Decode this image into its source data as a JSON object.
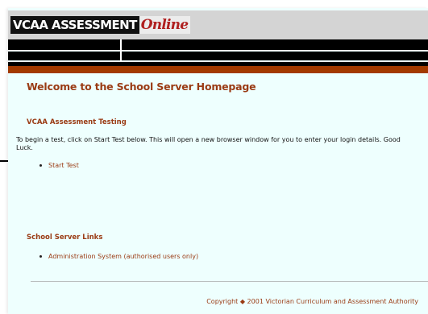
{
  "logo": {
    "main_text": "VCAA ASSESSMENT",
    "accent_text": "Online"
  },
  "page": {
    "welcome_heading": "Welcome to the School Server Homepage"
  },
  "assessment_section": {
    "heading": "VCAA Assessment Testing",
    "intro": "To begin a test, click on Start Test below. This will open a new browser window for you to enter your login details. Good Luck.",
    "start_test_link": "Start Test"
  },
  "links_section": {
    "heading": "School Server Links",
    "admin_link": "Administration System (authorised users only)"
  },
  "footer": {
    "copyright": "Copyright ◆ 2001 Victorian Curriculum and Assessment Authority"
  },
  "colors": {
    "background": "#eefffe",
    "accent_brown": "#9a3b14",
    "header_grey": "#d4d4d4",
    "bar_brown": "#a33a00",
    "logo_red": "#b02020"
  },
  "icons": {
    "pointer": "arrow-right-icon"
  }
}
